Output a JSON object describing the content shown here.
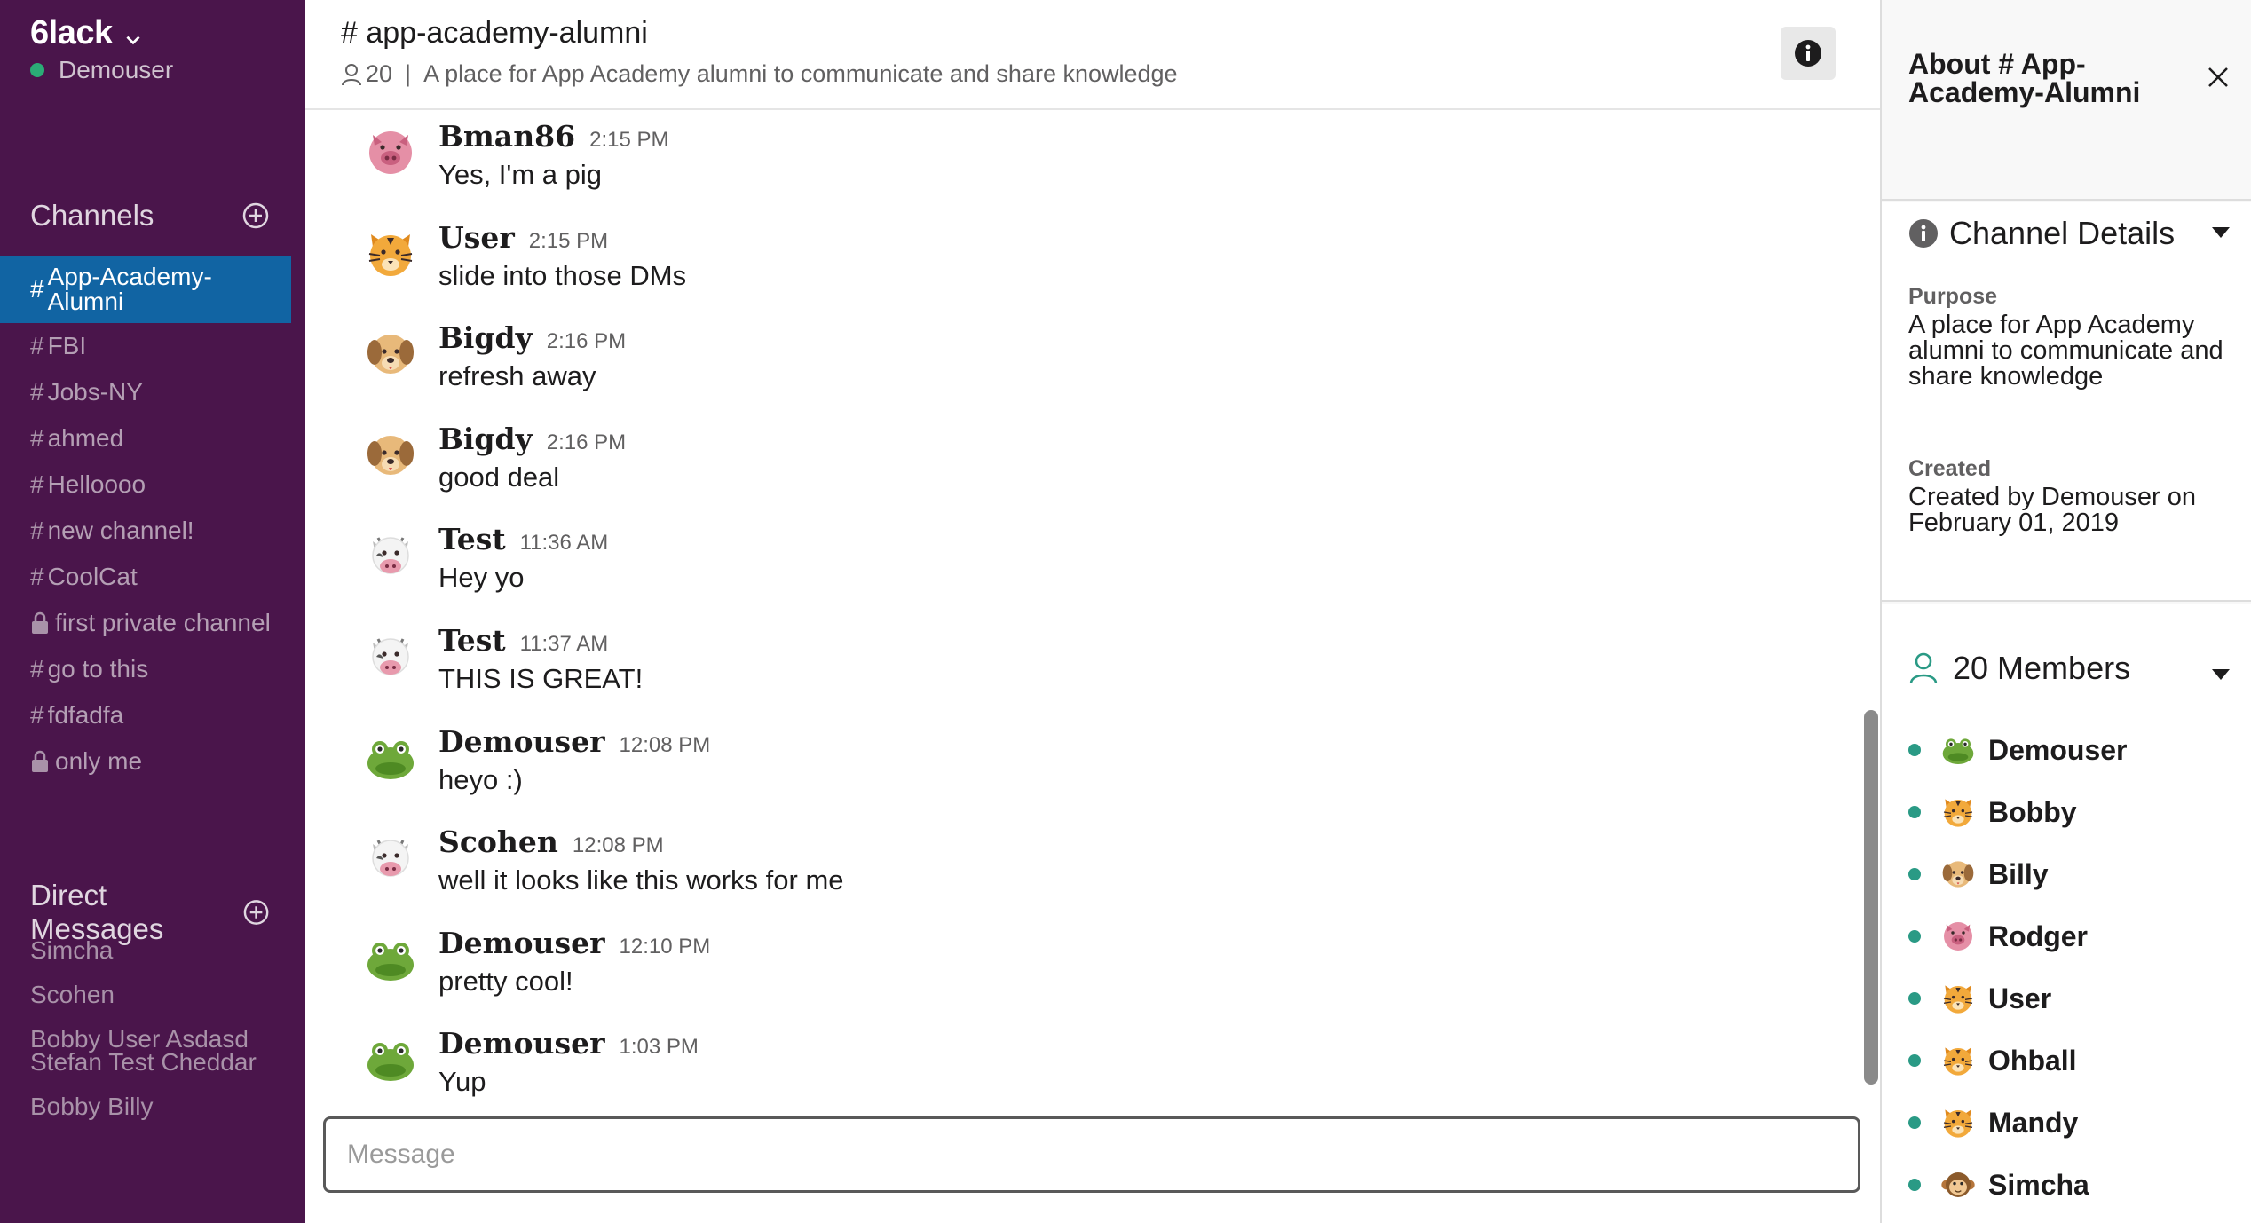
{
  "team": {
    "name": "6lack",
    "user": "Demouser"
  },
  "sidebar": {
    "channels_header": "Channels",
    "channels": [
      {
        "label": "App-Academy-Alumni",
        "private": false,
        "active": true
      },
      {
        "label": "FBI",
        "private": false
      },
      {
        "label": "Jobs-NY",
        "private": false
      },
      {
        "label": "ahmed",
        "private": false
      },
      {
        "label": "Helloooo",
        "private": false
      },
      {
        "label": "new channel!",
        "private": false
      },
      {
        "label": "CoolCat",
        "private": false
      },
      {
        "label": "first private channel",
        "private": true
      },
      {
        "label": "go to this",
        "private": false
      },
      {
        "label": "fdfadfa",
        "private": false
      },
      {
        "label": "only me",
        "private": true
      }
    ],
    "dm_header": "Direct Messages",
    "dms": [
      "Simcha",
      "Scohen",
      "Bobby User Asdasd Stefan Test Cheddar",
      "Bobby Billy"
    ]
  },
  "header": {
    "title": "# app-academy-alumni",
    "member_count": "20",
    "separator": "|",
    "purpose": "A place for App Academy alumni to communicate and share knowledge"
  },
  "messages": [
    {
      "author": "Bman86",
      "time": "2:15 PM",
      "text": "Yes, I'm a pig",
      "avatar": "pig"
    },
    {
      "author": "User",
      "time": "2:15 PM",
      "text": "slide into those DMs",
      "avatar": "tiger"
    },
    {
      "author": "Bigdy",
      "time": "2:16 PM",
      "text": "refresh away",
      "avatar": "dog"
    },
    {
      "author": "Bigdy",
      "time": "2:16 PM",
      "text": "good deal",
      "avatar": "dog"
    },
    {
      "author": "Test",
      "time": "11:36 AM",
      "text": "Hey yo",
      "avatar": "cow"
    },
    {
      "author": "Test",
      "time": "11:37 AM",
      "text": "THIS IS GREAT!",
      "avatar": "cow"
    },
    {
      "author": "Demouser",
      "time": "12:08 PM",
      "text": "heyo :)",
      "avatar": "frog"
    },
    {
      "author": "Scohen",
      "time": "12:08 PM",
      "text": "well it looks like this works for me",
      "avatar": "cow"
    },
    {
      "author": "Demouser",
      "time": "12:10 PM",
      "text": "pretty cool!",
      "avatar": "frog"
    },
    {
      "author": "Demouser",
      "time": "1:03 PM",
      "text": "Yup",
      "avatar": "frog"
    }
  ],
  "composer": {
    "placeholder": "Message"
  },
  "panel": {
    "title": "About # App-Academy-Alumni",
    "close": "X",
    "details_header": "Channel Details",
    "purpose_label": "Purpose",
    "purpose_text": "A place for App Academy alumni to communicate and share knowledge",
    "created_label": "Created",
    "created_text": "Created by Demouser on February 01, 2019",
    "members_header": "20 Members",
    "members": [
      {
        "name": "Demouser",
        "avatar": "frog"
      },
      {
        "name": "Bobby",
        "avatar": "tiger"
      },
      {
        "name": "Billy",
        "avatar": "dog"
      },
      {
        "name": "Rodger",
        "avatar": "pig"
      },
      {
        "name": "User",
        "avatar": "tiger"
      },
      {
        "name": "Ohball",
        "avatar": "tiger"
      },
      {
        "name": "Mandy",
        "avatar": "tiger"
      },
      {
        "name": "Simcha",
        "avatar": "monkey"
      }
    ]
  },
  "colors": {
    "sidebar_bg": "#4a154b",
    "active_channel": "#1164a3",
    "online": "#2bac76",
    "member_dot": "#2a9a85"
  }
}
